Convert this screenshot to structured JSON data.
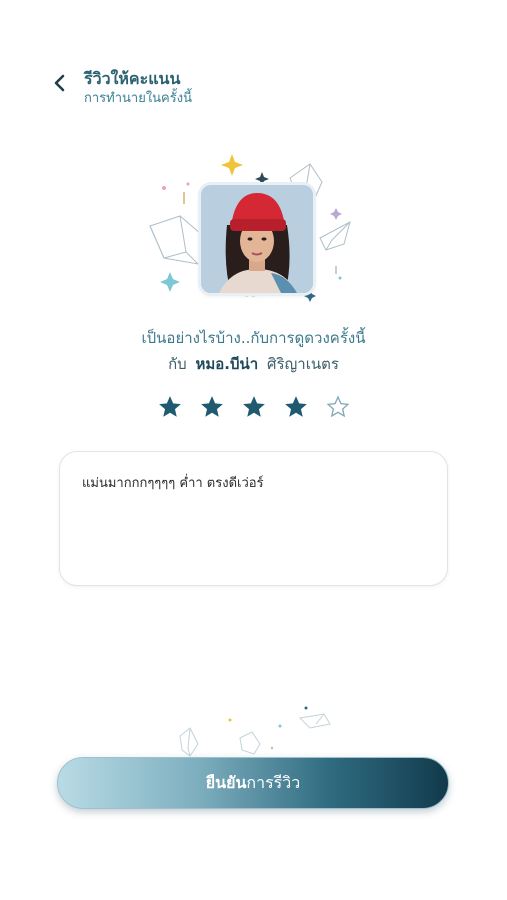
{
  "header": {
    "title": "รีวิวให้คะแนน",
    "subtitle": "การทำนายในครั้งนี้"
  },
  "icons": {
    "back": "chevron-left-icon",
    "star_filled": "star-filled-icon",
    "star_empty": "star-outline-icon"
  },
  "prompt": {
    "question": "เป็นอย่างไรบ้าง..กับการดูดวงครั้งนี้",
    "with_label": "กับ",
    "doctor_name": "หมอ.บีน่า",
    "doctor_surname": "ศิริญาเนตร"
  },
  "rating": {
    "value": 4,
    "max": 5
  },
  "review": {
    "text": "แม่นมากกกๆๆๆๆ ค่ำา ตรงดีเว่อร์"
  },
  "confirm": {
    "bold": "ยืนยัน",
    "normal": "การรีวิว"
  },
  "colors": {
    "accent": "#2c6172",
    "star": "#1f5a70",
    "button_dark": "#123a4c",
    "button_light": "#b9dbe6"
  }
}
